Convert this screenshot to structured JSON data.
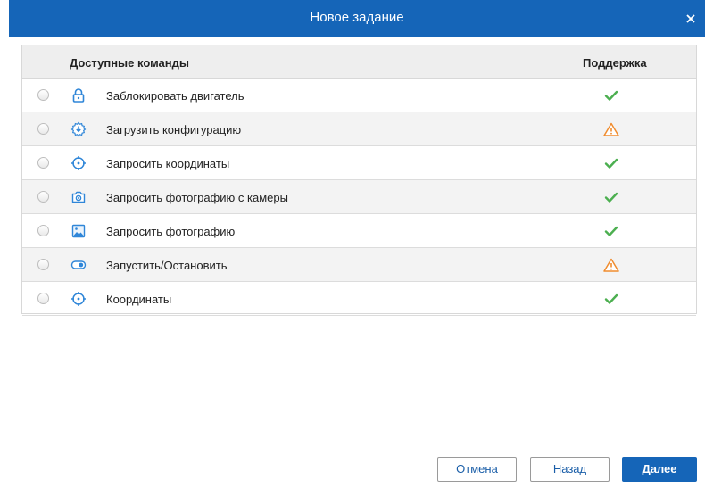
{
  "dialog": {
    "title": "Новое задание",
    "close_icon": "close-icon"
  },
  "grid": {
    "columns": {
      "name": "Доступные команды",
      "support": "Поддержка"
    },
    "rows": [
      {
        "icon": "lock-icon",
        "label": "Заблокировать двигатель",
        "support": "supported",
        "support_icon": "checkmark-icon"
      },
      {
        "icon": "gear-download-icon",
        "label": "Загрузить конфигурацию",
        "support": "warning",
        "support_icon": "warning-icon"
      },
      {
        "icon": "crosshair-icon",
        "label": "Запросить координаты",
        "support": "supported",
        "support_icon": "checkmark-icon"
      },
      {
        "icon": "camera-icon",
        "label": "Запросить фотографию с камеры",
        "support": "supported",
        "support_icon": "checkmark-icon"
      },
      {
        "icon": "image-icon",
        "label": "Запросить фотографию",
        "support": "supported",
        "support_icon": "checkmark-icon"
      },
      {
        "icon": "toggle-icon",
        "label": "Запустить/Остановить",
        "support": "warning",
        "support_icon": "warning-icon"
      },
      {
        "icon": "crosshair-icon",
        "label": "Координаты",
        "support": "supported",
        "support_icon": "checkmark-icon"
      }
    ]
  },
  "buttons": {
    "cancel": "Отмена",
    "back": "Назад",
    "next": "Далее"
  },
  "colors": {
    "accent": "#1565b8",
    "icon_blue": "#2f86d8",
    "check_green": "#4caf50",
    "warning_orange": "#f08c2e"
  }
}
